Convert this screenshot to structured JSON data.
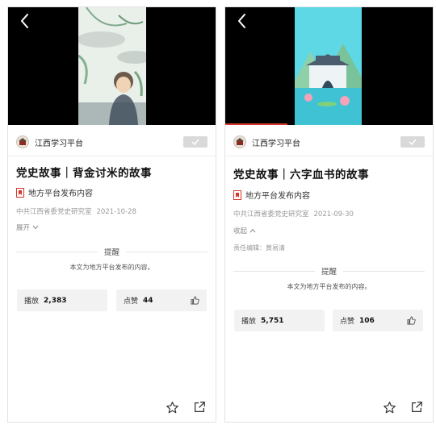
{
  "screens": [
    {
      "publisher": "江西学习平台",
      "title": "党史故事｜背金讨米的故事",
      "source_label": "地方平台发布内容",
      "author": "中共江西省委党史研究室",
      "date": "2021-10-28",
      "toggle_label": "展开",
      "editor": "",
      "notice_heading": "提醒",
      "notice_text": "本文为地方平台发布的内容。",
      "views_label": "播放",
      "views_value": "2,383",
      "likes_label": "点赞",
      "likes_value": "44",
      "video_caption": "",
      "progress": 0.0
    },
    {
      "publisher": "江西学习平台",
      "title": "党史故事｜六字血书的故事",
      "source_label": "地方平台发布内容",
      "author": "中共江西省委党史研究室",
      "date": "2021-09-30",
      "toggle_label": "收起",
      "editor": "责任编辑：黄易清",
      "notice_heading": "提醒",
      "notice_text": "本文为地方平台发布的内容。",
      "views_label": "播放",
      "views_value": "5,751",
      "likes_label": "点赞",
      "likes_value": "106",
      "video_caption": "",
      "progress": 0.3
    }
  ],
  "icons": {
    "back": "chevron-left-icon",
    "follow": "check-icon",
    "source_badge": "bookmark-icon",
    "toggle_down": "chevron-down-icon",
    "toggle_up": "chevron-up-icon",
    "like": "thumbs-up-icon",
    "favorite": "star-icon",
    "share": "share-icon"
  },
  "colors": {
    "accent_red": "#d4372b",
    "follow_button": "#d9d9d9",
    "stat_background": "#f2f2f2",
    "caption_yellow": "#ffe23a"
  }
}
